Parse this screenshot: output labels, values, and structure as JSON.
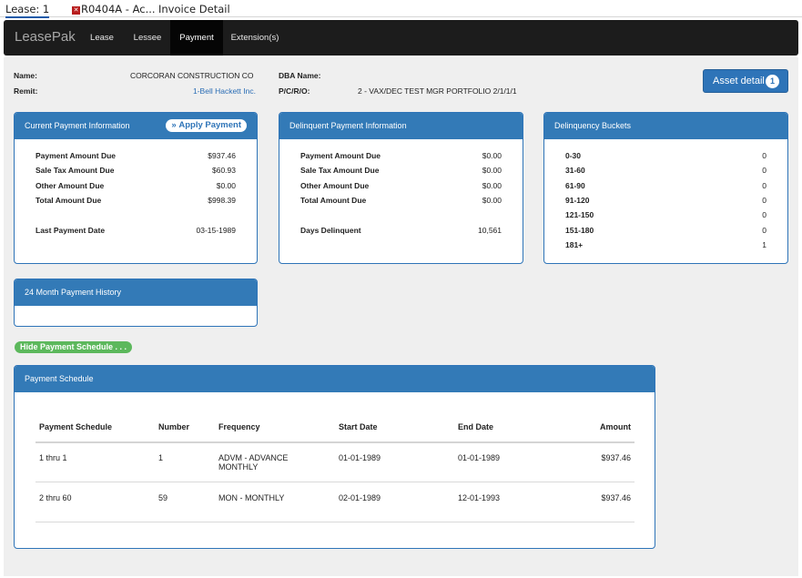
{
  "tabs": [
    {
      "label": "Lease: 1",
      "active": true
    },
    {
      "label": "R0404A - Ac...",
      "active": false
    },
    {
      "label": "Invoice Detail",
      "active": false
    }
  ],
  "navbar": {
    "brand": "LeasePak",
    "items": [
      "Lease",
      "Lessee",
      "Payment",
      "Extension(s)"
    ],
    "active": "Payment"
  },
  "header": {
    "name_label": "Name:",
    "name_value": "CORCORAN CONSTRUCTION CO",
    "remit_label": "Remit:",
    "remit_value": "1-Bell Hackett Inc.",
    "dba_label": "DBA Name:",
    "dba_value": "",
    "pcro_label": "P/C/R/O:",
    "pcro_value": "2 - VAX/DEC TEST MGR PORTFOLIO 2/1/1/1",
    "asset_button": "Asset detail",
    "asset_count": "1"
  },
  "current_payment": {
    "title": "Current Payment Information",
    "apply_button": "Apply Payment",
    "apply_icon": "»",
    "rows": [
      {
        "label": "Payment Amount Due",
        "value": "$937.46"
      },
      {
        "label": "Sale Tax Amount Due",
        "value": "$60.93"
      },
      {
        "label": "Other Amount Due",
        "value": "$0.00"
      },
      {
        "label": "Total Amount Due",
        "value": "$998.39"
      }
    ],
    "last_payment_label": "Last Payment Date",
    "last_payment_value": "03-15-1989"
  },
  "delinquent_payment": {
    "title": "Delinquent Payment Information",
    "rows": [
      {
        "label": "Payment Amount Due",
        "value": "$0.00"
      },
      {
        "label": "Sale Tax Amount Due",
        "value": "$0.00"
      },
      {
        "label": "Other Amount Due",
        "value": "$0.00"
      },
      {
        "label": "Total Amount Due",
        "value": "$0.00"
      }
    ],
    "days_label": "Days Delinquent",
    "days_value": "10,561"
  },
  "delinquency_buckets": {
    "title": "Delinquency Buckets",
    "rows": [
      {
        "label": "0-30",
        "value": "0"
      },
      {
        "label": "31-60",
        "value": "0"
      },
      {
        "label": "61-90",
        "value": "0"
      },
      {
        "label": "91-120",
        "value": "0"
      },
      {
        "label": "121-150",
        "value": "0"
      },
      {
        "label": "151-180",
        "value": "0"
      },
      {
        "label": "181+",
        "value": "1"
      }
    ]
  },
  "history": {
    "title": "24 Month Payment History"
  },
  "hide_schedule_button": "Hide Payment Schedule . . .",
  "schedule": {
    "title": "Payment Schedule",
    "columns": [
      "Payment Schedule",
      "Number",
      "Frequency",
      "Start Date",
      "End Date",
      "Amount"
    ],
    "rows": [
      {
        "schedule": "1 thru 1",
        "number": "1",
        "frequency": "ADVM - ADVANCE MONTHLY",
        "start": "01-01-1989",
        "end": "01-01-1989",
        "amount": "$937.46"
      },
      {
        "schedule": "2 thru 60",
        "number": "59",
        "frequency": "MON - MONTHLY",
        "start": "02-01-1989",
        "end": "12-01-1993",
        "amount": "$937.46"
      }
    ]
  },
  "colors": {
    "panel_header": "#337ab7",
    "link": "#2a6db5",
    "hide_button": "#5cb85c",
    "navbar": "#1c1c1c"
  }
}
